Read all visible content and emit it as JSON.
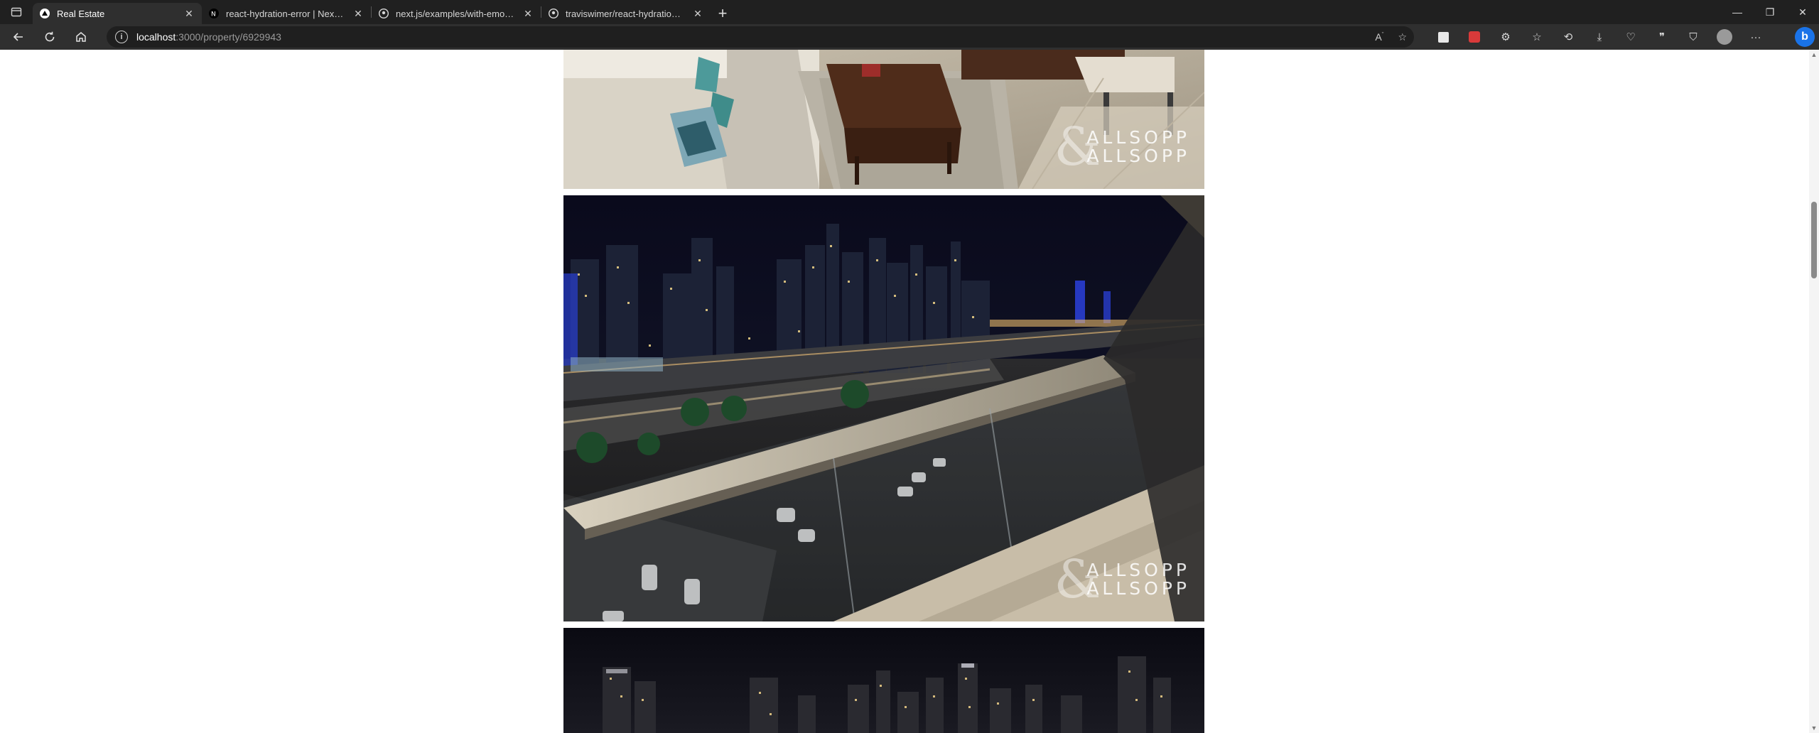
{
  "browser": {
    "tabs": [
      {
        "title": "Real Estate",
        "active": true,
        "icon": "triangle-icon"
      },
      {
        "title": "react-hydration-error | Next.js",
        "active": false,
        "icon": "nextjs-icon"
      },
      {
        "title": "next.js/examples/with-emotion a",
        "active": false,
        "icon": "github-icon"
      },
      {
        "title": "traviswimer/react-hydration-pro",
        "active": false,
        "icon": "github-icon"
      }
    ],
    "address": {
      "host": "localhost",
      "path": ":3000/property/6929943"
    }
  },
  "page": {
    "photos": [
      {
        "alt": "living room with sofa and coffee table",
        "watermark_line1": "ALLSOPP",
        "watermark_line2": "ALLSOPP"
      },
      {
        "alt": "balcony night view of city skyline",
        "watermark_line1": "ALLSOPP",
        "watermark_line2": "ALLSOPP"
      },
      {
        "alt": "night city skyline",
        "watermark_line1": "",
        "watermark_line2": ""
      }
    ]
  },
  "colors": {
    "chrome_dark": "#202020",
    "toolbar": "#2f2f2f",
    "accent": "#1a73e8"
  }
}
